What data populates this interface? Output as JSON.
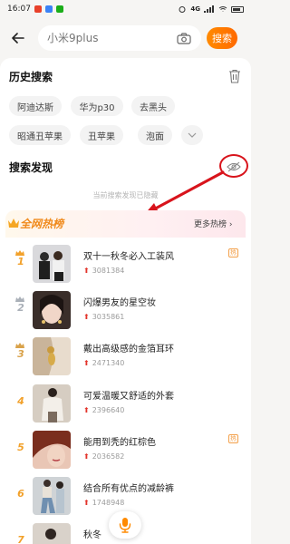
{
  "status_bar": {
    "time": "16:07",
    "signal_text": "4G",
    "battery_icon": "battery-icon",
    "app_icon_colors": [
      "#e8402a",
      "#3b82f6",
      "#1aad19"
    ]
  },
  "search": {
    "placeholder": "小米9plus",
    "button_label": "搜索",
    "camera_icon": "camera-icon",
    "back_icon": "back-arrow-icon",
    "accent": "#ff7a00"
  },
  "history": {
    "title": "历史搜索",
    "delete_icon": "trash-icon",
    "chips": [
      "阿迪达斯",
      "华为p30",
      "去黑头",
      "昭通丑苹果",
      "丑苹果",
      "泡面"
    ],
    "expand_icon": "chevron-down-icon"
  },
  "discover": {
    "title": "搜索发现",
    "visibility_icon": "eye-hidden-icon",
    "hidden_note": "当前搜索发现已隐藏"
  },
  "hot_list": {
    "title": "全网热榜",
    "more_label": "更多热榜",
    "more_icon": "chevron-right-icon",
    "items": [
      {
        "rank": "1",
        "title": "双十一秋冬必入工装风",
        "count": "3081384",
        "badge": "热"
      },
      {
        "rank": "2",
        "title": "闪爆男友的星空妆",
        "count": "3035861",
        "badge": ""
      },
      {
        "rank": "3",
        "title": "戴出高级感的金箔耳环",
        "count": "2471340",
        "badge": ""
      },
      {
        "rank": "4",
        "title": "可爱温暖又舒适的外套",
        "count": "2396640",
        "badge": ""
      },
      {
        "rank": "5",
        "title": "能用到秃的红棕色",
        "count": "2036582",
        "badge": "热"
      },
      {
        "rank": "6",
        "title": "结合所有优点的减龄裤",
        "count": "1748948",
        "badge": ""
      },
      {
        "rank": "7",
        "title": "秋冬",
        "count": "",
        "badge": ""
      }
    ]
  },
  "voice": {
    "mic_icon": "microphone-icon",
    "accent": "#ff8a00"
  },
  "annotation": {
    "color": "#d8141c"
  }
}
